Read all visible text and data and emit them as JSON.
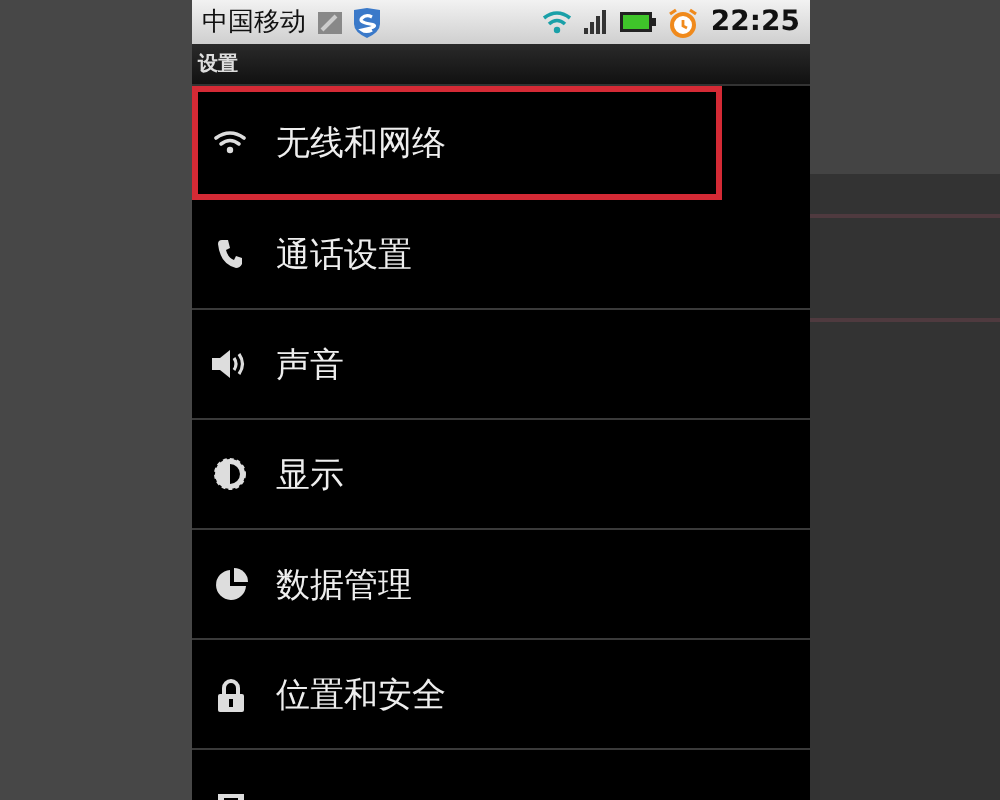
{
  "status_bar": {
    "carrier": "中国移动",
    "time": "22:25"
  },
  "title_bar": {
    "title": "设置"
  },
  "settings": [
    {
      "label": "无线和网络",
      "highlighted": true
    },
    {
      "label": "通话设置",
      "highlighted": false
    },
    {
      "label": "声音",
      "highlighted": false
    },
    {
      "label": "显示",
      "highlighted": false
    },
    {
      "label": "数据管理",
      "highlighted": false
    },
    {
      "label": "位置和安全",
      "highlighted": false
    },
    {
      "highlighted": false
    }
  ]
}
